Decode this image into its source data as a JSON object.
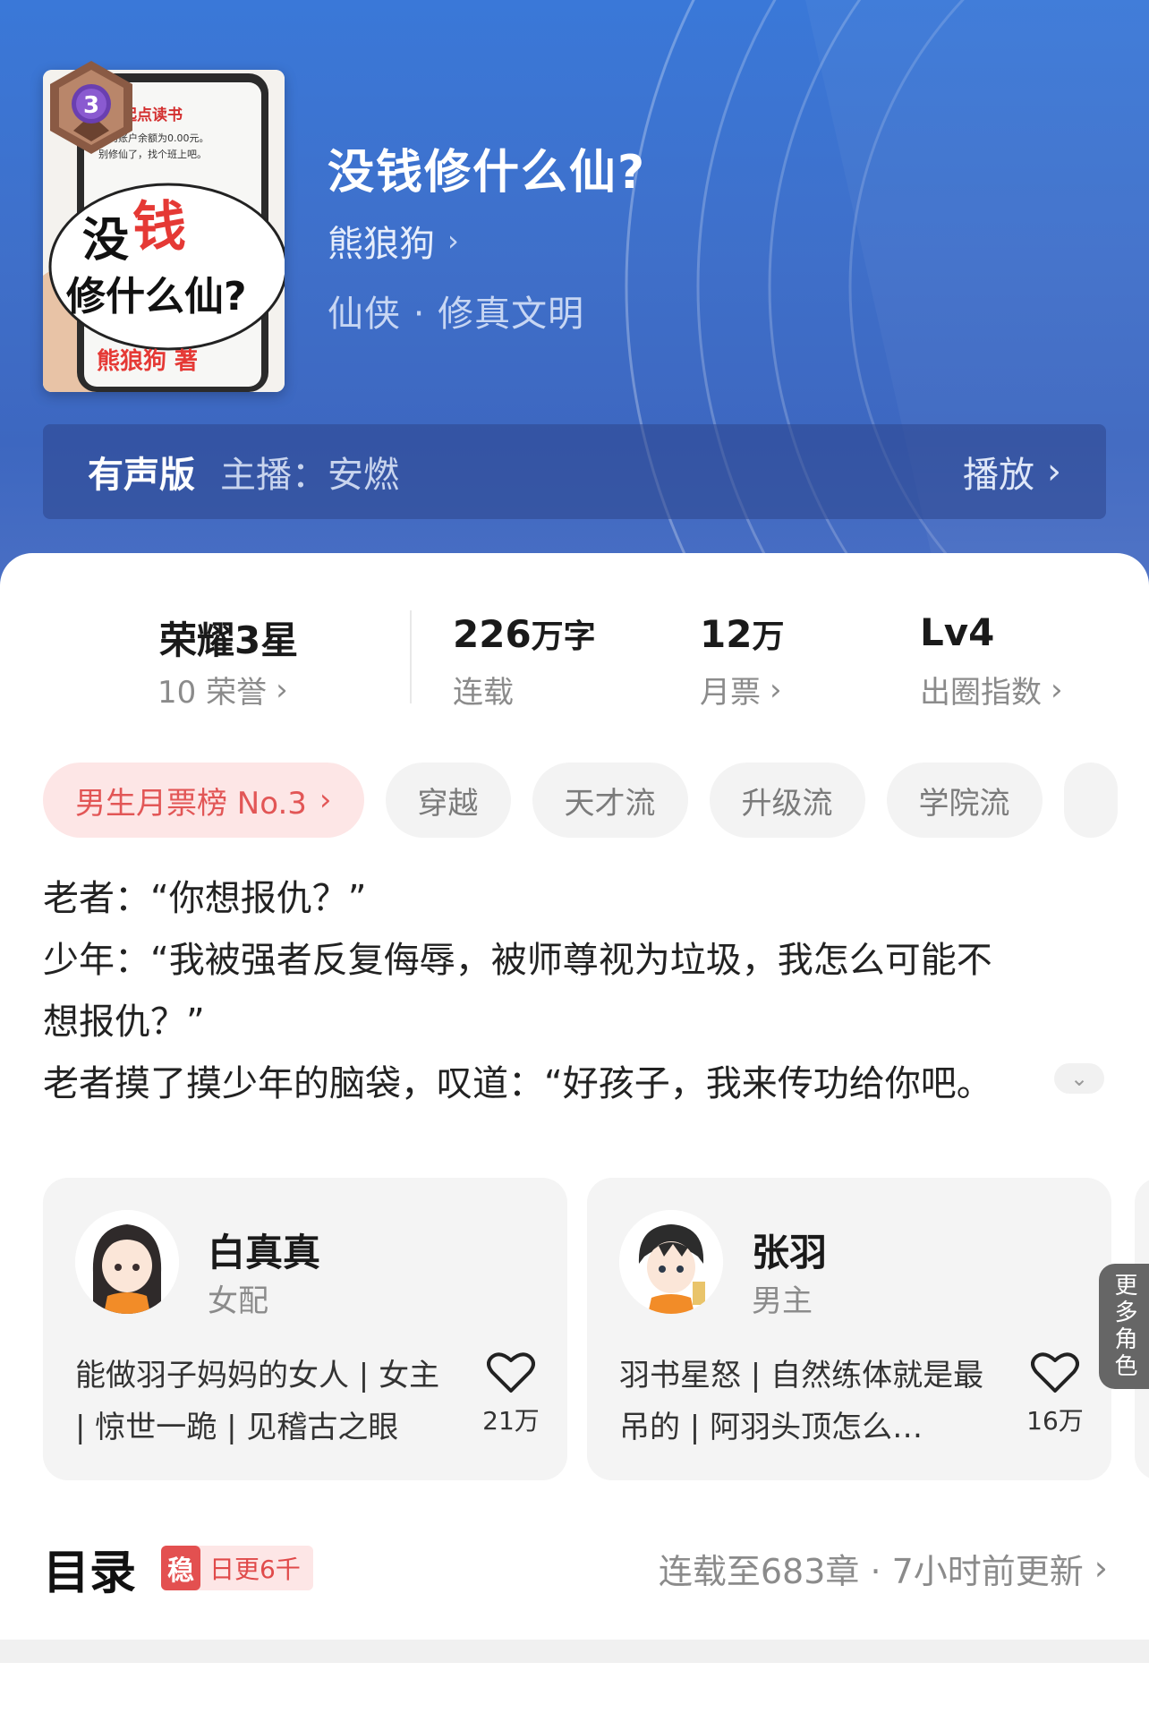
{
  "book": {
    "title": "没钱修什么仙?",
    "author": "熊狼狗",
    "genre": "仙侠 · 修真文明",
    "cover": {
      "app_brand": "起点读书",
      "phone_text_line1": "您的账户余额为0.00元。",
      "phone_text_line2": "别修仙了，找个班上吧。",
      "big_title_part1": "没",
      "big_title_part2": "钱",
      "big_title_line2": "修什么仙?",
      "byline": "熊狼狗 著"
    }
  },
  "audio": {
    "label": "有声版",
    "host": "主播：安燃",
    "play_label": "播放"
  },
  "stats": {
    "honor": {
      "title": "荣耀3星",
      "badge_level": "3",
      "sub": "10 荣誉"
    },
    "words": {
      "value": "226",
      "unit": "万字",
      "sub": "连载"
    },
    "tickets": {
      "value": "12",
      "unit": "万",
      "sub": "月票"
    },
    "level": {
      "value": "Lv4",
      "sub": "出圈指数"
    }
  },
  "tags": [
    "男生月票榜 No.3",
    "穿越",
    "天才流",
    "升级流",
    "学院流"
  ],
  "intro": [
    "老者：“你想报仇？”",
    "少年：“我被强者反复侮辱，被师尊视为垃圾，我怎么可能不",
    "想报仇？”",
    "老者摸了摸少年的脑袋，叹道：“好孩子，我来传功给你吧。"
  ],
  "characters": [
    {
      "name": "白真真",
      "role": "女配",
      "desc": "能做羽子妈妈的女人 | 女主 | 惊世一跪 | 见稽古之眼",
      "likes": "21万"
    },
    {
      "name": "张羽",
      "role": "男主",
      "desc": "羽书星怒 | 自然练体就是最吊的 | 阿羽头顶怎么…",
      "likes": "16万"
    }
  ],
  "more_roles": "更多角色",
  "toc": {
    "title": "目录",
    "stable_mark": "稳",
    "stable_text": "日更6千",
    "status": "连载至683章 · 7小时前更新"
  },
  "colors": {
    "hero_top": "#3a78d8",
    "accent_red": "#e25656",
    "tag_bg": "#f3f3f3"
  }
}
